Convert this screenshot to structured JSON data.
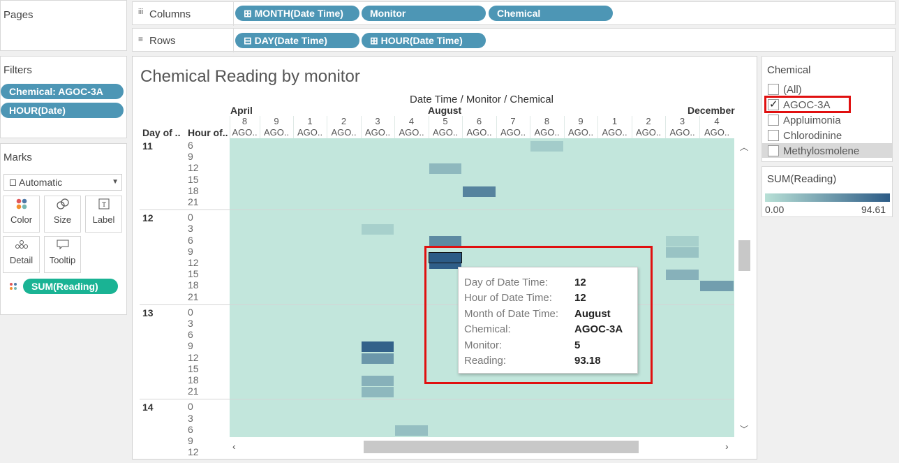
{
  "shelves": {
    "pages_label": "Pages",
    "columns_label": "Columns",
    "rows_label": "Rows",
    "columns_pills": [
      "⊞ MONTH(Date Time)",
      "Monitor",
      "Chemical"
    ],
    "rows_pills": [
      "⊟ DAY(Date Time)",
      "⊞ HOUR(Date Time)"
    ]
  },
  "filters": {
    "label": "Filters",
    "items": [
      "Chemical: AGOC-3A",
      "HOUR(Date)"
    ]
  },
  "marks": {
    "label": "Marks",
    "type": "Automatic",
    "cards": [
      {
        "label": "Color",
        "icon": "color-icon"
      },
      {
        "label": "Size",
        "icon": "size-icon"
      },
      {
        "label": "Label",
        "icon": "label-icon"
      },
      {
        "label": "Detail",
        "icon": "detail-icon"
      },
      {
        "label": "Tooltip",
        "icon": "tooltip-icon"
      }
    ],
    "field": "SUM(Reading)"
  },
  "view": {
    "title": "Chemical Reading by monitor",
    "col_header_title": "Date Time / Monitor / Chemical",
    "months": [
      "April",
      "August",
      "December"
    ],
    "monitors": [
      "8",
      "9",
      "1",
      "2",
      "3",
      "4",
      "5",
      "6",
      "7",
      "8",
      "9",
      "1",
      "2",
      "3",
      "4"
    ],
    "chem_abbrev": "AGO..",
    "row_header_day": "Day of ..",
    "row_header_hour": "Hour of..",
    "days": [
      {
        "day": "11",
        "hours": [
          "6",
          "9",
          "12",
          "15",
          "18",
          "21"
        ]
      },
      {
        "day": "12",
        "hours": [
          "0",
          "3",
          "6",
          "9",
          "12",
          "15",
          "18",
          "21"
        ]
      },
      {
        "day": "13",
        "hours": [
          "0",
          "3",
          "6",
          "9",
          "12",
          "15",
          "18",
          "21"
        ]
      },
      {
        "day": "14",
        "hours": [
          "0",
          "3",
          "6",
          "9",
          "12"
        ]
      }
    ]
  },
  "chemical_filter": {
    "title": "Chemical",
    "options": [
      {
        "label": "(All)",
        "checked": false
      },
      {
        "label": "AGOC-3A",
        "checked": true
      },
      {
        "label": "Appluimonia",
        "checked": false
      },
      {
        "label": "Chlorodinine",
        "checked": false
      },
      {
        "label": "Methylosmolene",
        "checked": false
      }
    ]
  },
  "color_legend": {
    "title": "SUM(Reading)",
    "min": "0.00",
    "max": "94.61",
    "low_color": "#b8e0d6",
    "high_color": "#2c5b86"
  },
  "tooltip": {
    "rows": [
      {
        "k": "Day of Date Time:",
        "v": "12"
      },
      {
        "k": "Hour of Date Time:",
        "v": "12"
      },
      {
        "k": "Month of Date Time:",
        "v": "August"
      },
      {
        "k": "Chemical:",
        "v": "AGOC-3A"
      },
      {
        "k": "Monitor:",
        "v": "5"
      },
      {
        "k": "Reading:",
        "v": "93.18"
      }
    ]
  },
  "heatmap_highlights": [
    {
      "day": "11",
      "hour": "6",
      "col": 9,
      "level": 0.15
    },
    {
      "day": "11",
      "hour": "12",
      "col": 6,
      "level": 0.3
    },
    {
      "day": "11",
      "hour": "18",
      "col": 7,
      "level": 0.7
    },
    {
      "day": "12",
      "hour": "3",
      "col": 4,
      "level": 0.12
    },
    {
      "day": "12",
      "hour": "6",
      "col": 6,
      "level": 0.65
    },
    {
      "day": "12",
      "hour": "6",
      "col": 13,
      "level": 0.12
    },
    {
      "day": "12",
      "hour": "9",
      "col": 13,
      "level": 0.22
    },
    {
      "day": "12",
      "hour": "12",
      "col": 6,
      "level": 0.98
    },
    {
      "day": "12",
      "hour": "15",
      "col": 13,
      "level": 0.35
    },
    {
      "day": "12",
      "hour": "18",
      "col": 14,
      "level": 0.5
    },
    {
      "day": "13",
      "hour": "9",
      "col": 4,
      "level": 0.95
    },
    {
      "day": "13",
      "hour": "12",
      "col": 4,
      "level": 0.55
    },
    {
      "day": "13",
      "hour": "18",
      "col": 4,
      "level": 0.35
    },
    {
      "day": "13",
      "hour": "21",
      "col": 4,
      "level": 0.3
    },
    {
      "day": "14",
      "hour": "6",
      "col": 5,
      "level": 0.25
    }
  ]
}
